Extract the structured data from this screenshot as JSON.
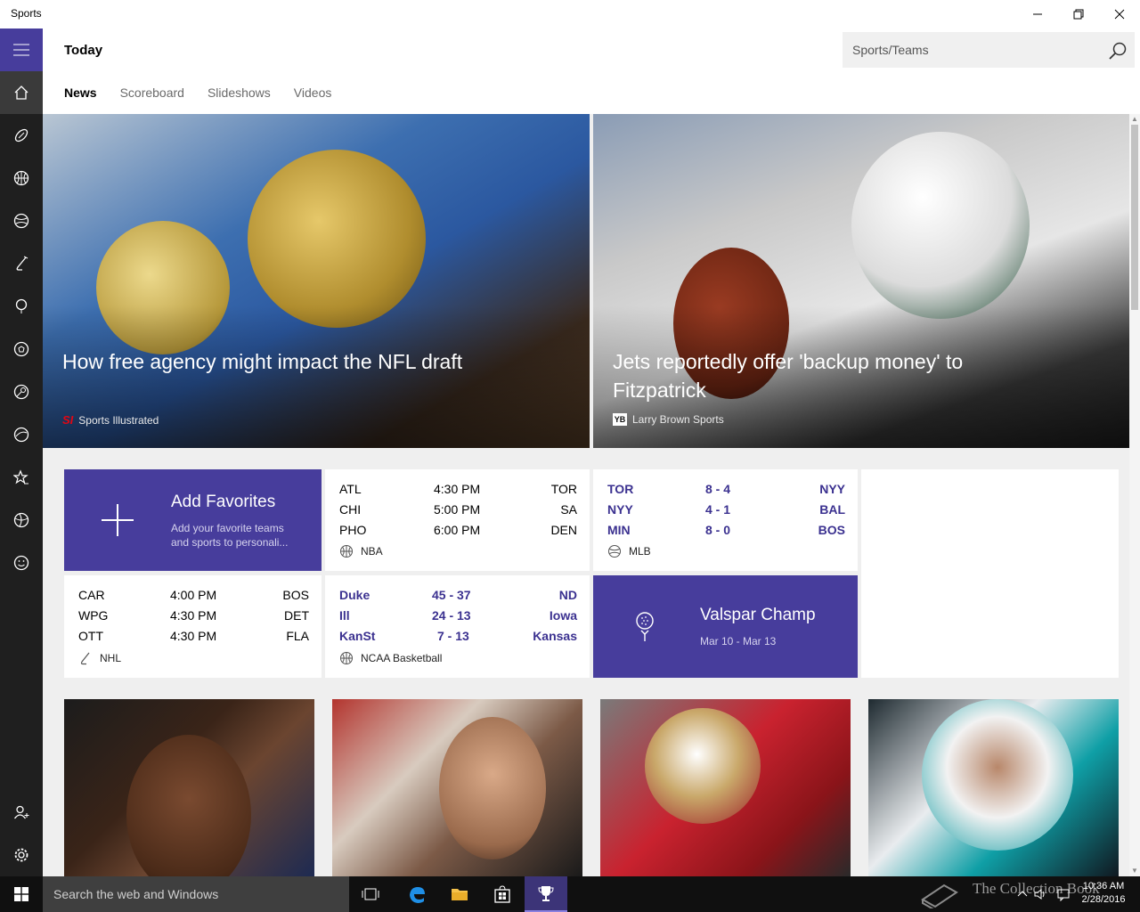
{
  "window": {
    "title": "Sports"
  },
  "header": {
    "title": "Today",
    "search_placeholder": "Sports/Teams",
    "tabs": [
      {
        "label": "News",
        "active": true
      },
      {
        "label": "Scoreboard",
        "active": false
      },
      {
        "label": "Slideshows",
        "active": false
      },
      {
        "label": "Videos",
        "active": false
      }
    ]
  },
  "nav": {
    "icons": [
      "menu-icon",
      "home-icon",
      "football-icon",
      "basketball-icon",
      "baseball-icon",
      "hockey-icon",
      "golf-icon",
      "soccer-icon",
      "tennis-icon",
      "college-icon",
      "favorites-icon",
      "sports-icon",
      "fun-icon",
      "account-icon",
      "settings-icon"
    ]
  },
  "hero": [
    {
      "title": "How free agency might impact the NFL draft",
      "source": "Sports Illustrated",
      "logo": "SI"
    },
    {
      "title": "Jets reportedly offer 'backup money' to Fitzpatrick",
      "source": "Larry Brown Sports",
      "logo": "YB"
    }
  ],
  "favorites": {
    "title": "Add Favorites",
    "subtitle": "Add your favorite teams and sports to personali..."
  },
  "scoreboards": {
    "nba": {
      "league": "NBA",
      "rows": [
        {
          "team1": "ATL",
          "middle": "4:30 PM",
          "team2": "TOR"
        },
        {
          "team1": "CHI",
          "middle": "5:00 PM",
          "team2": "SA"
        },
        {
          "team1": "PHO",
          "middle": "6:00 PM",
          "team2": "DEN"
        }
      ]
    },
    "mlb": {
      "league": "MLB",
      "rows": [
        {
          "team1": "TOR",
          "middle": "8  -  4",
          "team2": "NYY"
        },
        {
          "team1": "NYY",
          "middle": "4  -  1",
          "team2": "BAL"
        },
        {
          "team1": "MIN",
          "middle": "8  -  0",
          "team2": "BOS"
        }
      ]
    },
    "nhl": {
      "league": "NHL",
      "rows": [
        {
          "team1": "CAR",
          "middle": "4:00 PM",
          "team2": "BOS"
        },
        {
          "team1": "WPG",
          "middle": "4:30 PM",
          "team2": "DET"
        },
        {
          "team1": "OTT",
          "middle": "4:30 PM",
          "team2": "FLA"
        }
      ]
    },
    "ncaa": {
      "league": "NCAA Basketball",
      "rows": [
        {
          "team1": "Duke",
          "middle": "45  -  37",
          "team2": "ND"
        },
        {
          "team1": "Ill",
          "middle": "24  -  13",
          "team2": "Iowa"
        },
        {
          "team1": "KanSt",
          "middle": "7  -  13",
          "team2": "Kansas"
        }
      ]
    }
  },
  "golf": {
    "title": "Valspar Champ",
    "dates": "Mar 10 - Mar 13"
  },
  "taskbar": {
    "search_placeholder": "Search the web and Windows",
    "watermark": "The Collection Book",
    "time": "10:36 AM",
    "date": "2/28/2016"
  },
  "colors": {
    "accent": "#473d9c",
    "nav_bg": "#1f1f1f",
    "score_bold": "#3b3190"
  }
}
